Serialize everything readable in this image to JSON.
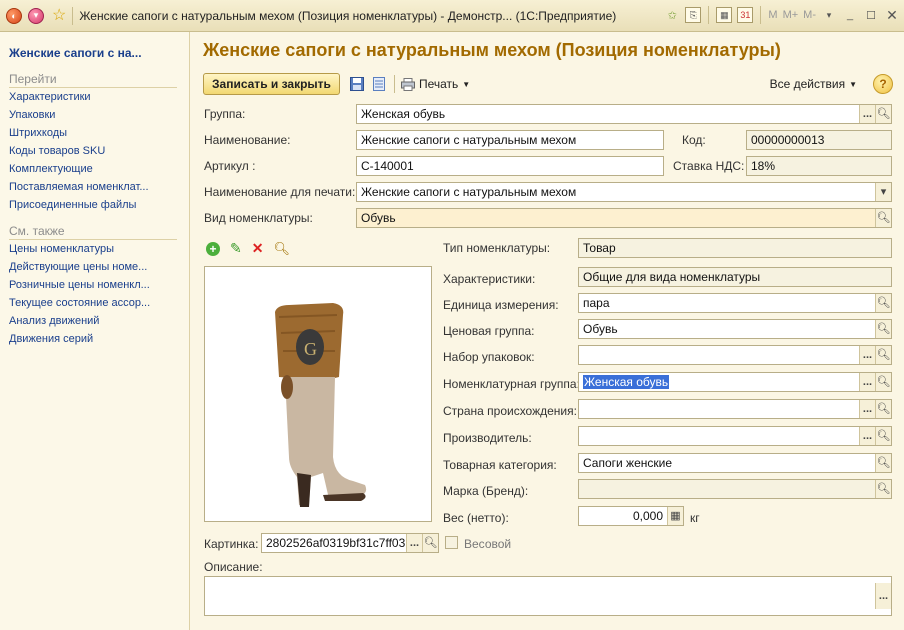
{
  "window": {
    "title": "Женские сапоги с натуральным мехом (Позиция номенклатуры) - Демонстр... (1С:Предприятие)",
    "controls": [
      "M",
      "M+",
      "M-"
    ]
  },
  "nav": {
    "title": "Женские сапоги с на...",
    "goto_header": "Перейти",
    "goto_items": [
      "Характеристики",
      "Упаковки",
      "Штрихкоды",
      "Коды товаров SKU",
      "Комплектующие",
      "Поставляемая номенклат...",
      "Присоединенные файлы"
    ],
    "see_also_header": "См. также",
    "see_also_items": [
      "Цены номенклатуры",
      "Действующие цены номе...",
      "Розничные цены номенкл...",
      "Текущее состояние ассор...",
      "Анализ движений",
      "Движения серий"
    ]
  },
  "page": {
    "title": "Женские сапоги с натуральным мехом (Позиция номенклатуры)"
  },
  "toolbar": {
    "save_close": "Записать и закрыть",
    "print": "Печать",
    "all_actions": "Все действия",
    "help": "?"
  },
  "form": {
    "group_label": "Группа:",
    "group_value": "Женская обувь",
    "name_label": "Наименование:",
    "name_value": "Женские сапоги с натуральным мехом",
    "code_label": "Код:",
    "code_value": "00000000013",
    "article_label": "Артикул :",
    "article_value": "С-140001",
    "vat_label": "Ставка НДС:",
    "vat_value": "18%",
    "print_name_label": "Наименование для печати:",
    "print_name_value": "Женские сапоги с натуральным мехом",
    "kind_label": "Вид номенклатуры:",
    "kind_value": "Обувь",
    "type_label": "Тип номенклатуры:",
    "type_value": "Товар",
    "chars_label": "Характеристики:",
    "chars_value": "Общие для вида номенклатуры",
    "unit_label": "Единица измерения:",
    "unit_value": "пара",
    "price_group_label": "Ценовая группа:",
    "price_group_value": "Обувь",
    "pack_set_label": "Набор упаковок:",
    "pack_set_value": "",
    "nom_group_label": "Номенклатурная группа:",
    "nom_group_value": "Женская обувь",
    "country_label": "Страна происхождения:",
    "country_value": "",
    "maker_label": "Производитель:",
    "maker_value": "",
    "category_label": "Товарная категория:",
    "category_value": "Сапоги женские",
    "brand_label": "Марка (Бренд):",
    "brand_value": "",
    "weight_label": "Вес (нетто):",
    "weight_value": "0,000",
    "weight_unit": "кг",
    "picture_label": "Картинка:",
    "picture_value": "2802526af0319bf31c7ff03",
    "weighable_label": "Весовой",
    "description_label": "Описание:",
    "description_value": ""
  }
}
